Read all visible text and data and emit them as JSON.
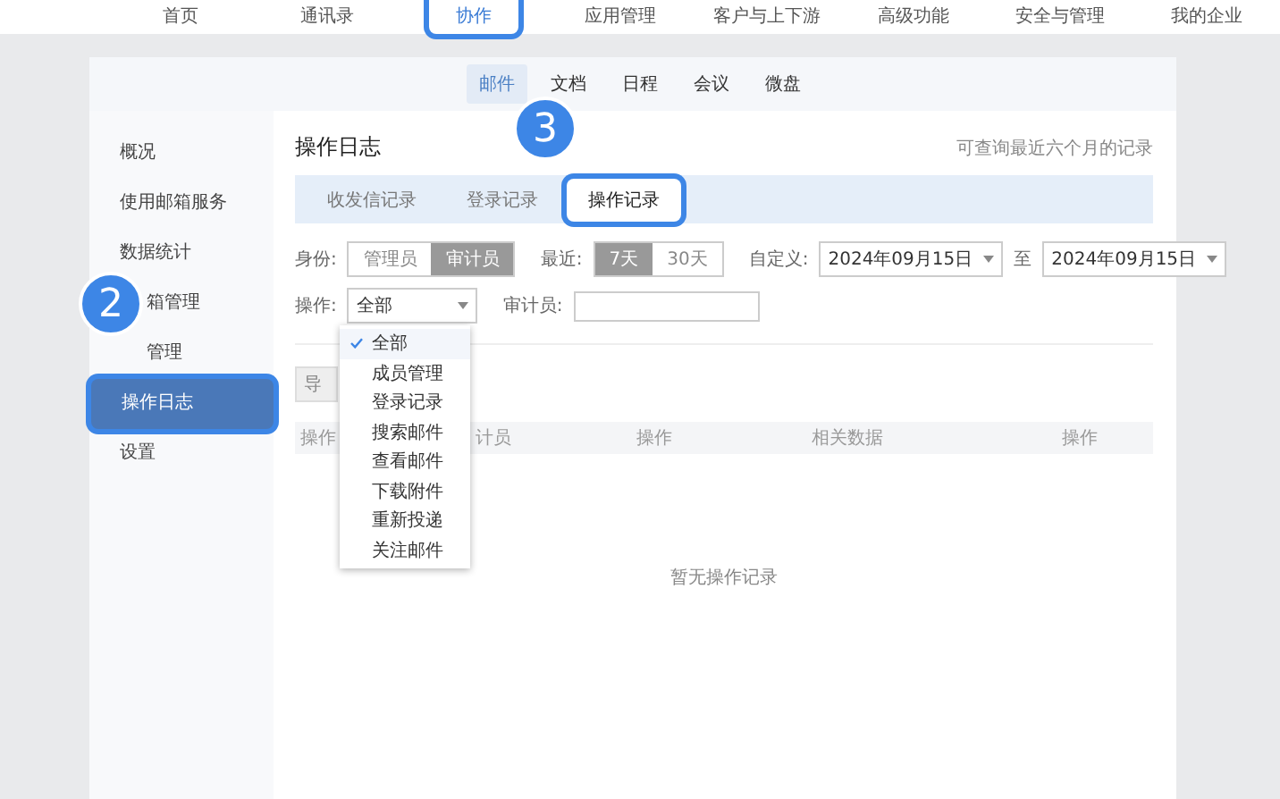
{
  "top_nav": [
    {
      "label": "首页",
      "selected": false,
      "highlighted": false
    },
    {
      "label": "通讯录",
      "selected": false,
      "highlighted": false
    },
    {
      "label": "协作",
      "selected": true,
      "highlighted": true
    },
    {
      "label": "应用管理",
      "selected": false,
      "highlighted": false
    },
    {
      "label": "客户与上下游",
      "selected": false,
      "highlighted": false
    },
    {
      "label": "高级功能",
      "selected": false,
      "highlighted": false
    },
    {
      "label": "安全与管理",
      "selected": false,
      "highlighted": false
    },
    {
      "label": "我的企业",
      "selected": false,
      "highlighted": false
    }
  ],
  "sub_nav": [
    {
      "label": "邮件",
      "selected": true
    },
    {
      "label": "文档",
      "selected": false
    },
    {
      "label": "日程",
      "selected": false
    },
    {
      "label": "会议",
      "selected": false
    },
    {
      "label": "微盘",
      "selected": false
    }
  ],
  "sidebar": {
    "items": [
      {
        "label": "概况",
        "selected": false,
        "highlighted": false
      },
      {
        "label": "使用邮箱服务",
        "selected": false,
        "highlighted": false
      },
      {
        "label": "数据统计",
        "selected": false,
        "highlighted": false
      },
      {
        "label": "箱管理",
        "selected": false,
        "highlighted": false,
        "callout": "2"
      },
      {
        "label": "管理",
        "selected": false,
        "highlighted": false
      },
      {
        "label": "操作日志",
        "selected": true,
        "highlighted": true
      },
      {
        "label": "设置",
        "selected": false,
        "highlighted": false
      }
    ]
  },
  "content": {
    "title": "操作日志",
    "note": "可查询最近六个月的记录",
    "tabs": [
      {
        "label": "收发信记录",
        "selected": false,
        "highlighted": false
      },
      {
        "label": "登录记录",
        "selected": false,
        "highlighted": false
      },
      {
        "label": "操作记录",
        "selected": true,
        "highlighted": true,
        "callout": "3"
      }
    ],
    "identity": {
      "label": "身份:",
      "options": [
        {
          "label": "管理员",
          "selected": false
        },
        {
          "label": "审计员",
          "selected": true
        }
      ]
    },
    "recent": {
      "label": "最近:",
      "options": [
        {
          "label": "7天",
          "selected": true
        },
        {
          "label": "30天",
          "selected": false
        }
      ]
    },
    "custom": {
      "label": "自定义:",
      "from": "2024年09月15日",
      "separator": "至",
      "to": "2024年09月15日"
    },
    "operation": {
      "label": "操作:",
      "value": "全部",
      "expanded": true,
      "options": [
        {
          "label": "全部",
          "selected": true
        },
        {
          "label": "成员管理",
          "selected": false
        },
        {
          "label": "登录记录",
          "selected": false
        },
        {
          "label": "搜索邮件",
          "selected": false
        },
        {
          "label": "查看邮件",
          "selected": false
        },
        {
          "label": "下载附件",
          "selected": false
        },
        {
          "label": "重新投递",
          "selected": false
        },
        {
          "label": "关注邮件",
          "selected": false
        }
      ]
    },
    "auditor": {
      "label": "审计员:"
    },
    "export_button": "导",
    "table": {
      "columns": [
        "操作",
        "计员",
        "操作",
        "相关数据",
        "操作"
      ],
      "empty": "暂无操作记录"
    }
  }
}
